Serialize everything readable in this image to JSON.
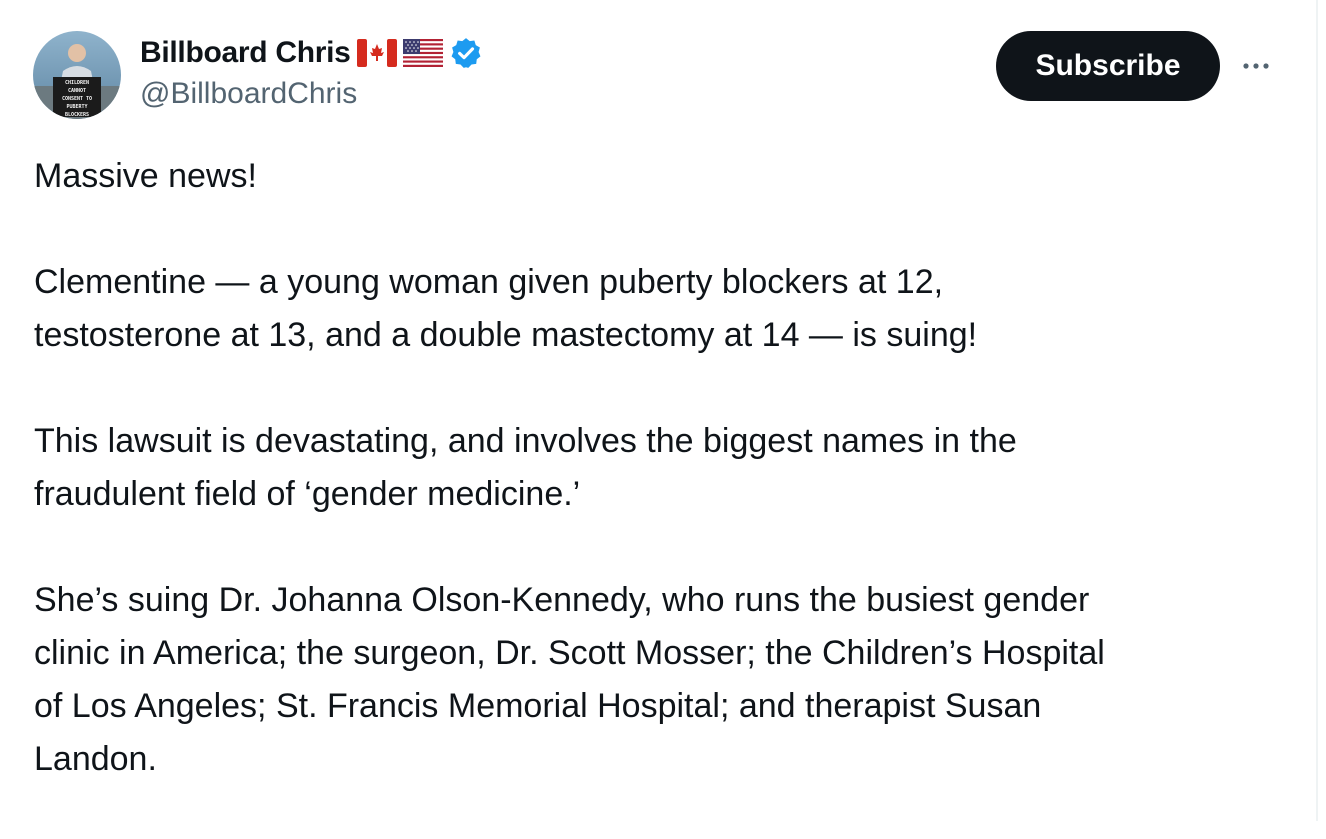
{
  "author": {
    "display_name": "Billboard Chris",
    "handle": "@BillboardChris",
    "flags": [
      "canada-flag-icon",
      "usa-flag-icon"
    ],
    "verified_icon": "verified-badge-icon",
    "avatar_sign_text": [
      "CHILDREN",
      "CANNOT",
      "CONSENT TO",
      "PUBERTY",
      "BLOCKERS"
    ]
  },
  "actions": {
    "subscribe_label": "Subscribe",
    "more_icon": "more-dots-icon"
  },
  "tweet": {
    "paragraphs": [
      "Massive news!",
      "Clementine — a young woman given puberty blockers at 12,\ntestosterone at 13, and a double mastectomy at 14 — is suing!",
      "This lawsuit is devastating, and involves the biggest names in the\nfraudulent field of ‘gender medicine.’",
      "She’s suing Dr. Johanna Olson-Kennedy, who runs the busiest gender\nclinic in America; the surgeon, Dr. Scott Mosser; the Children’s Hospital\nof Los Angeles; St. Francis Memorial Hospital; and therapist Susan\nLandon."
    ]
  },
  "colors": {
    "text_primary": "#0f1419",
    "text_secondary": "#536471",
    "verified_blue": "#1d9bf0",
    "button_bg": "#0f1419",
    "button_text": "#ffffff"
  }
}
